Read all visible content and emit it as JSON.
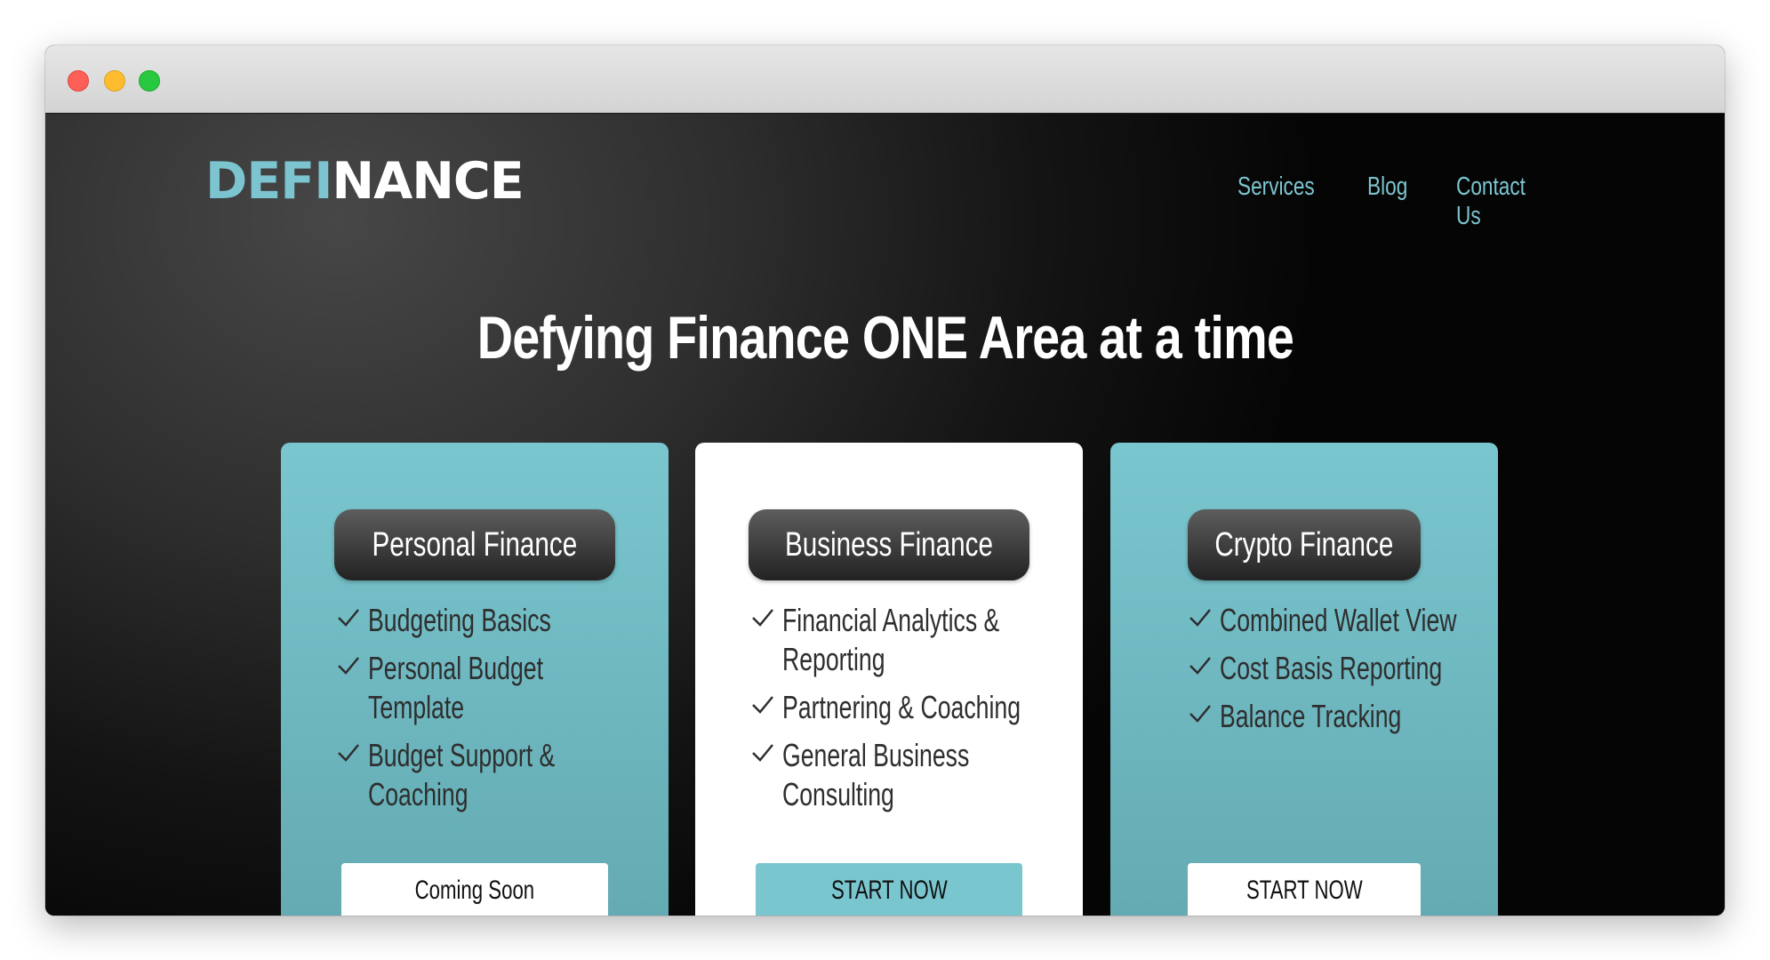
{
  "brand": {
    "logo_part1": "DEFI",
    "logo_part2": "NANCE"
  },
  "nav": {
    "items": [
      "Services",
      "Blog",
      "Contact Us"
    ]
  },
  "hero": {
    "title": "Defying Finance ONE Area at a time"
  },
  "colors": {
    "accent": "#7cc4cf",
    "dark": "#222222",
    "card_teal": "#6eb8c1",
    "white": "#ffffff"
  },
  "cards": [
    {
      "title": "Personal Finance",
      "features": [
        "Budgeting Basics",
        "Personal Budget Template",
        "Budget Support & Coaching"
      ],
      "cta": "Coming Soon"
    },
    {
      "title": "Business Finance",
      "features": [
        "Financial Analytics & Reporting",
        "Partnering & Coaching",
        "General Business Consulting"
      ],
      "cta": "START NOW"
    },
    {
      "title": "Crypto Finance",
      "features": [
        "Combined Wallet View",
        "Cost Basis Reporting",
        "Balance Tracking"
      ],
      "cta": "START NOW"
    }
  ],
  "icons": {
    "feature_bullet": "checkmark-icon"
  }
}
